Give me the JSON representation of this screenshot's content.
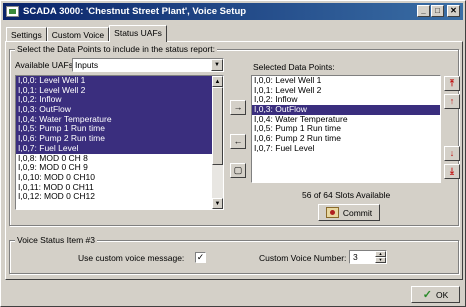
{
  "window": {
    "title": "SCADA 3000: 'Chestnut Street Plant', Voice Setup",
    "minimize_glyph": "_",
    "maximize_glyph": "□",
    "close_glyph": "✕"
  },
  "tabs": [
    {
      "label": "Settings"
    },
    {
      "label": "Custom Voice"
    },
    {
      "label": "Status UAFs",
      "active": true
    }
  ],
  "data_points_group": {
    "legend": "Select the Data Points to include in the status report:",
    "available_label": "Available UAFs:",
    "available_select": "Inputs",
    "selected_label": "Selected Data Points:",
    "available_items": [
      {
        "text": "I,0,0: Level Well 1",
        "selected": true
      },
      {
        "text": "I,0,1: Level Well 2",
        "selected": true
      },
      {
        "text": "I,0,2: Inflow",
        "selected": true
      },
      {
        "text": "I,0,3: OutFlow",
        "selected": true
      },
      {
        "text": "I,0,4: Water Temperature",
        "selected": true
      },
      {
        "text": "I,0,5: Pump 1 Run time",
        "selected": true
      },
      {
        "text": "I,0,6: Pump 2 Run time",
        "selected": true
      },
      {
        "text": "I,0,7: Fuel Level",
        "selected": true
      },
      {
        "text": "I,0,8: MOD 0 CH 8",
        "selected": false
      },
      {
        "text": "I,0,9: MOD 0 CH 9",
        "selected": false
      },
      {
        "text": "I,0,10: MOD 0 CH10",
        "selected": false
      },
      {
        "text": "I,0,11: MOD 0 CH11",
        "selected": false
      },
      {
        "text": "I,0,12: MOD 0 CH12",
        "selected": false
      }
    ],
    "selected_items": [
      {
        "text": "I,0,0: Level Well 1",
        "selected": false
      },
      {
        "text": "I,0,1: Level Well 2",
        "selected": false
      },
      {
        "text": "I,0,2: Inflow",
        "selected": false
      },
      {
        "text": "I,0,3: OutFlow",
        "selected": true
      },
      {
        "text": "I,0,4: Water Temperature",
        "selected": false
      },
      {
        "text": "I,0,5: Pump 1 Run time",
        "selected": false
      },
      {
        "text": "I,0,6: Pump 2 Run time",
        "selected": false
      },
      {
        "text": "I,0,7: Fuel Level",
        "selected": false
      }
    ],
    "slots_text": "56 of 64 Slots Available",
    "commit_label": "Commit"
  },
  "voice_group": {
    "legend": "Voice Status Item #3",
    "custom_message_label": "Use custom voice message:",
    "custom_message_checked": "✓",
    "custom_number_label": "Custom Voice Number:",
    "custom_number_value": "3"
  },
  "ok_label": "OK",
  "icons": {
    "add": "→",
    "remove": "←",
    "move_top": "⤒",
    "move_up": "↑",
    "move_down": "↓",
    "move_bottom": "⤓",
    "down_arrow": "▼",
    "up_arrow": "▲"
  },
  "colors": {
    "title_start": "#0a246a",
    "title_end": "#3a6ea5",
    "selection": "#3a2e7e",
    "face": "#d4d0c8",
    "arrow_red": "#c01010",
    "ok_green": "#2a8a2a"
  }
}
